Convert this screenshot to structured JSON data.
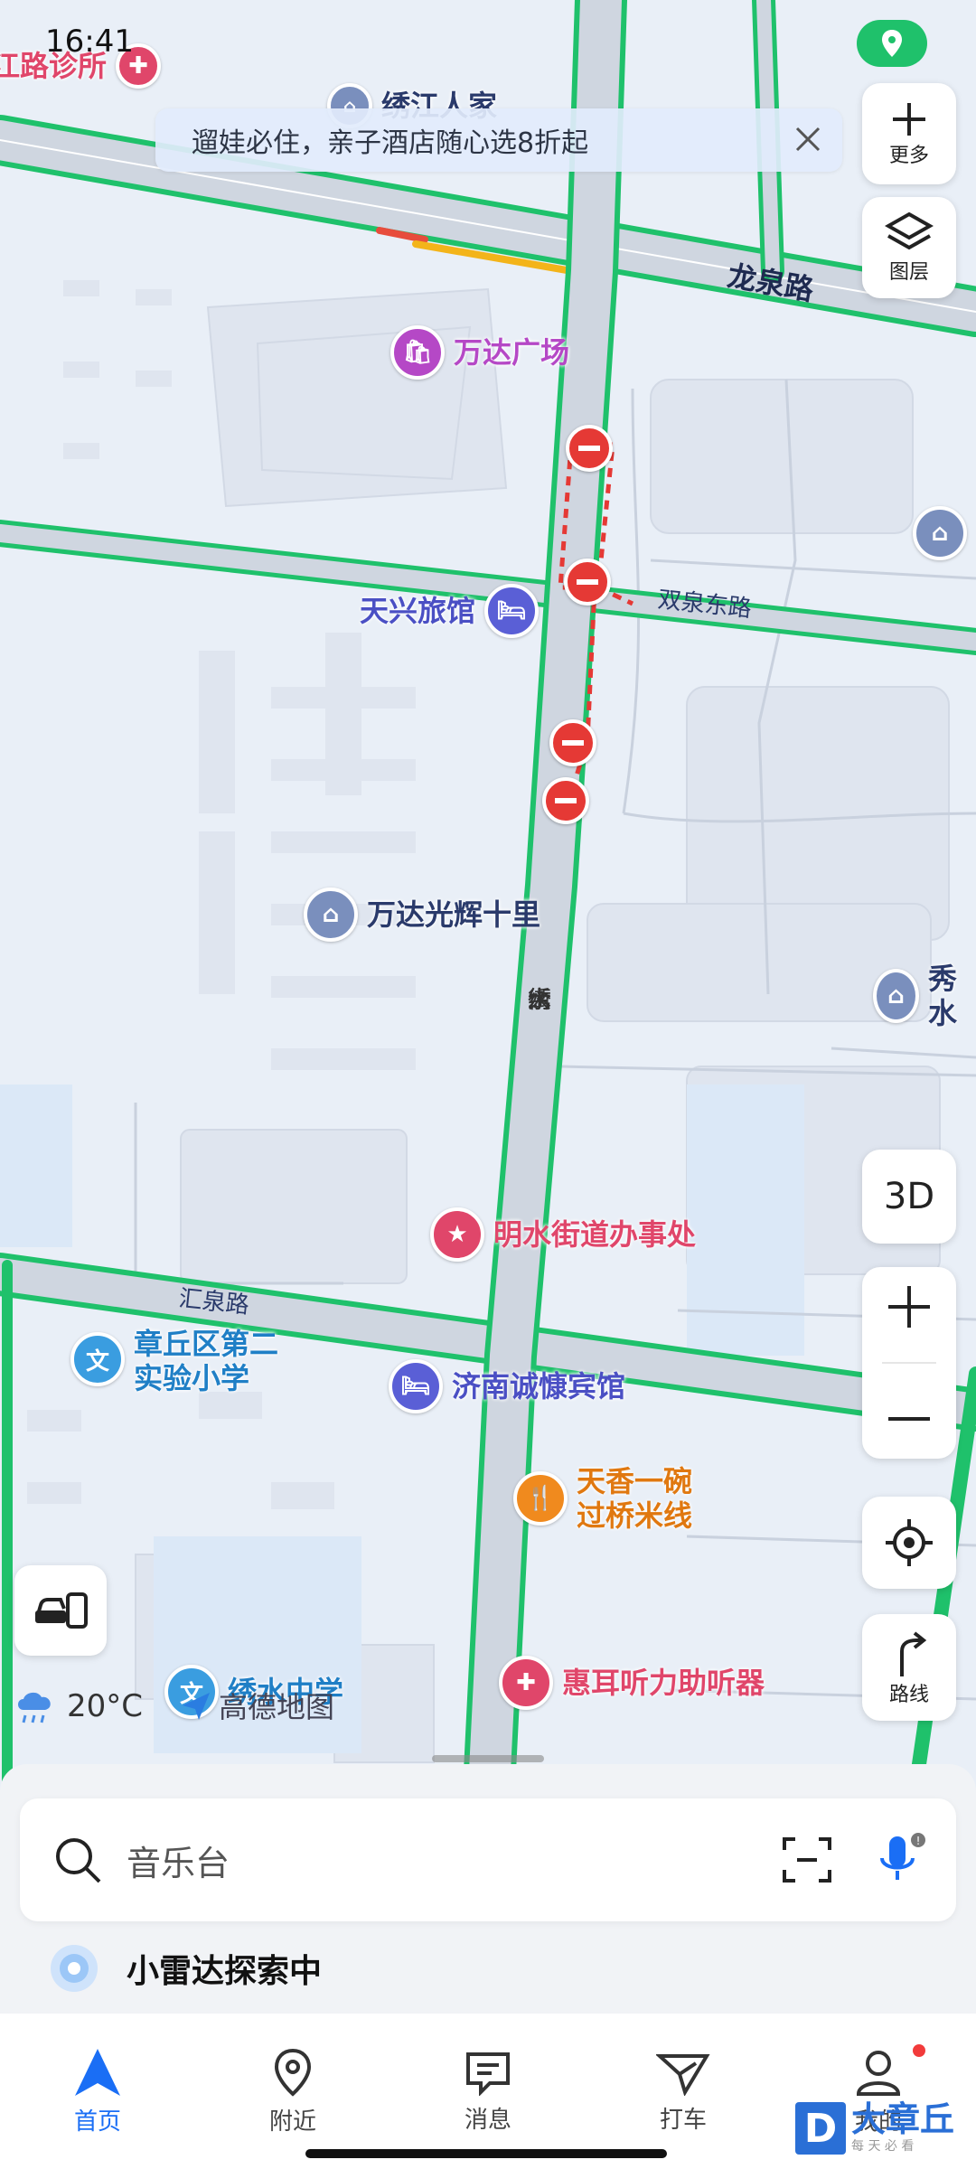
{
  "status_bar": {
    "time": "16:41"
  },
  "banner": {
    "text": "遛娃必住，亲子酒店随心选8折起"
  },
  "side_buttons": {
    "more": "更多",
    "layers": "图层",
    "three_d": "3D",
    "route": "路线"
  },
  "roads": {
    "longquan": "龙泉路",
    "shuangquan_east": "双泉东路",
    "huiquan": "汇泉路",
    "xiushui_street": [
      "绣",
      "水",
      "大",
      "街"
    ]
  },
  "pois": {
    "top_left_clinic": "江路诊所",
    "top_home": "绣江人家",
    "wanda_plaza": "万达广场",
    "tianxing_hotel": "天兴旅馆",
    "wanda_guanghui": "万达光辉十里",
    "xiushui_right": "秀水",
    "mingshui_office": "明水街道办事处",
    "school_line1": "章丘区第二",
    "school_line2": "实验小学",
    "jinan_hotel": "济南诚慷宾馆",
    "noodle_line1": "天香一碗",
    "noodle_line2": "过桥米线",
    "hearing_aid": "惠耳听力助听器",
    "xiushui_middle": "绣水中学"
  },
  "weather": {
    "temp": "20°C",
    "icon": "rain-cloud-icon"
  },
  "brand": {
    "amap": "高德地图"
  },
  "search": {
    "placeholder": "音乐台"
  },
  "radar": {
    "text": "小雷达探索中"
  },
  "tabs": [
    "首页",
    "附近",
    "消息",
    "打车",
    "我的"
  ],
  "watermark": {
    "title": "大章丘",
    "sub": "每 天 必 看"
  },
  "colors": {
    "accent": "#1a6ef5",
    "road_green": "#1fc16b",
    "closure": "#e53935"
  }
}
